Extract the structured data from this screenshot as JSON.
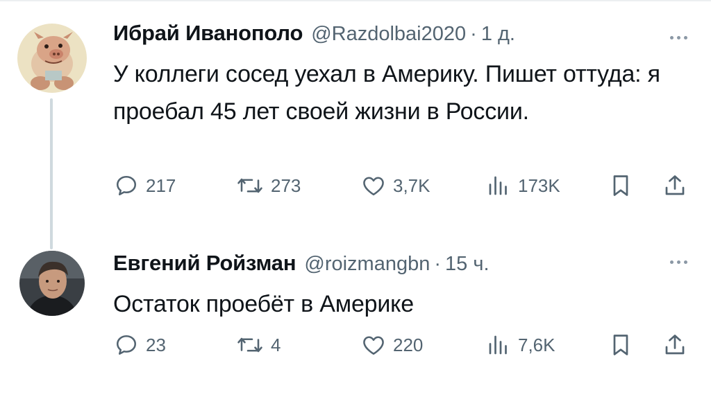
{
  "tweets": [
    {
      "author_name": "Ибрай Иванополо",
      "handle": "@Razdolbai2020",
      "separator": "·",
      "time": "1 д.",
      "avatar_icon": "cartoon-pig-avatar",
      "text": "У коллеги сосед уехал в Америку.  Пишет оттуда: я проебал 45 лет своей жизни в России.",
      "stats": {
        "replies": "217",
        "retweets": "273",
        "likes": "3,7K",
        "views": "173K"
      }
    },
    {
      "author_name": "Евгений Ройзман",
      "handle": "@roizmangbn",
      "separator": "·",
      "time": "15 ч.",
      "avatar_icon": "man-photo-avatar",
      "text": "Остаток проебёт в Америке",
      "stats": {
        "replies": "23",
        "retweets": "4",
        "likes": "220",
        "views": "7,6K"
      }
    }
  ],
  "colors": {
    "text": "#0f1419",
    "secondary": "#536471",
    "thread_line": "#cfd9de"
  }
}
